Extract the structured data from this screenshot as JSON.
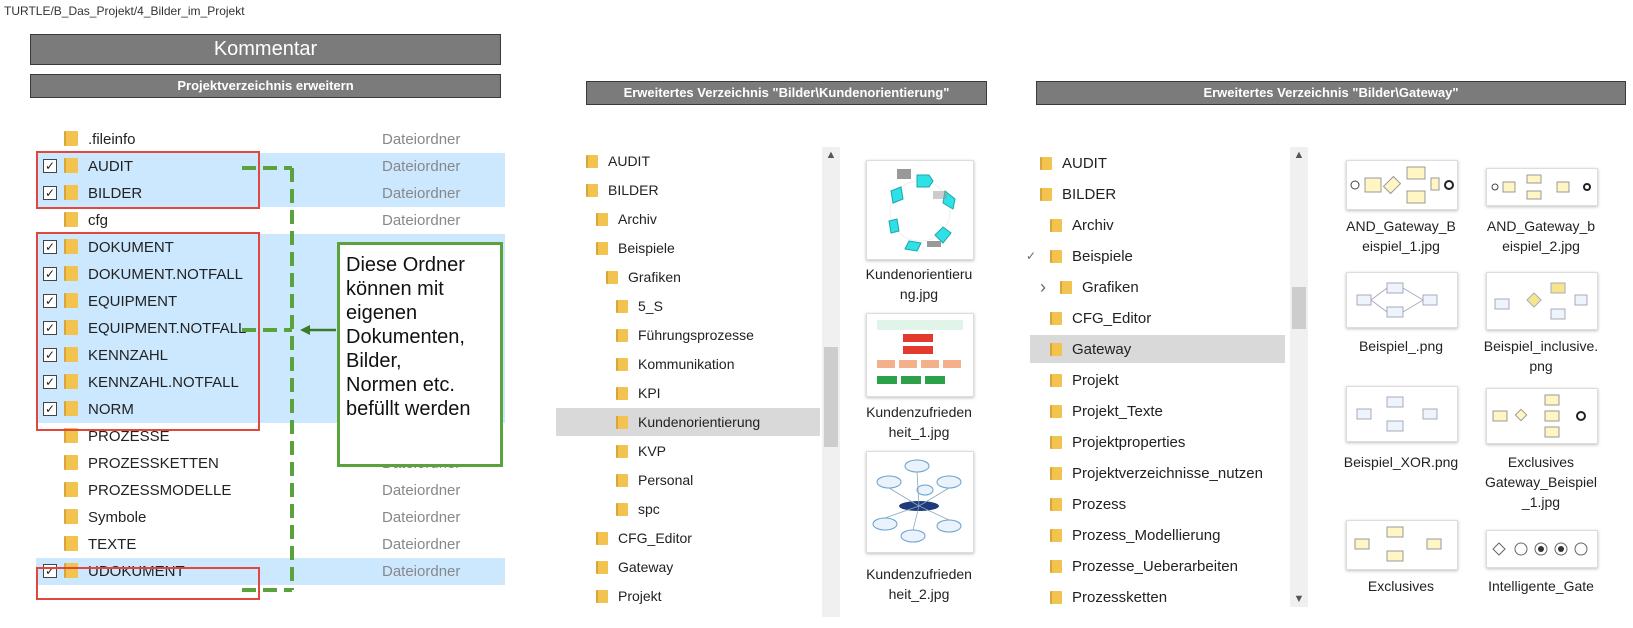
{
  "breadcrumb": "TURTLE/B_Das_Projekt/4_Bilder_im_Projekt",
  "title": "Kommentar",
  "left_panel": {
    "header": "Projektverzeichnis erweitern",
    "rows": [
      {
        "name": ".fileinfo",
        "type": "Dateiordner",
        "checked": false,
        "selected": false
      },
      {
        "name": "AUDIT",
        "type": "Dateiordner",
        "checked": true,
        "selected": true
      },
      {
        "name": "BILDER",
        "type": "Dateiordner",
        "checked": true,
        "selected": true
      },
      {
        "name": "cfg",
        "type": "Dateiordner",
        "checked": false,
        "selected": false
      },
      {
        "name": "DOKUMENT",
        "type": "",
        "checked": true,
        "selected": true
      },
      {
        "name": "DOKUMENT.NOTFALL",
        "type": "",
        "checked": true,
        "selected": true
      },
      {
        "name": "EQUIPMENT",
        "type": "",
        "checked": true,
        "selected": true
      },
      {
        "name": "EQUIPMENT.NOTFALL",
        "type": "",
        "checked": true,
        "selected": true
      },
      {
        "name": "KENNZAHL",
        "type": "",
        "checked": true,
        "selected": true
      },
      {
        "name": "KENNZAHL.NOTFALL",
        "type": "",
        "checked": true,
        "selected": true
      },
      {
        "name": "NORM",
        "type": "",
        "checked": true,
        "selected": true
      },
      {
        "name": "PROZESSE",
        "type": "",
        "checked": false,
        "selected": false
      },
      {
        "name": "PROZESSKETTEN",
        "type": "Dateiordner",
        "checked": false,
        "selected": false
      },
      {
        "name": "PROZESSMODELLE",
        "type": "Dateiordner",
        "checked": false,
        "selected": false
      },
      {
        "name": "Symbole",
        "type": "Dateiordner",
        "checked": false,
        "selected": false
      },
      {
        "name": "TEXTE",
        "type": "Dateiordner",
        "checked": false,
        "selected": false
      },
      {
        "name": "UDOKUMENT",
        "type": "Dateiordner",
        "checked": true,
        "selected": true
      }
    ],
    "comment_lines": [
      "Diese Ordner",
      "können mit",
      "eigenen",
      "Dokumenten,",
      "Bilder,",
      "Normen etc.",
      "befüllt werden"
    ]
  },
  "middle_panel": {
    "header": "Erweitertes Verzeichnis \"Bilder\\Kundenorientierung\"",
    "tree": [
      {
        "name": "AUDIT",
        "indent": 0
      },
      {
        "name": "BILDER",
        "indent": 0
      },
      {
        "name": "Archiv",
        "indent": 1
      },
      {
        "name": "Beispiele",
        "indent": 1
      },
      {
        "name": "Grafiken",
        "indent": 2
      },
      {
        "name": "5_S",
        "indent": 3
      },
      {
        "name": "Führungsprozesse",
        "indent": 3
      },
      {
        "name": "Kommunikation",
        "indent": 3
      },
      {
        "name": "KPI",
        "indent": 3
      },
      {
        "name": "Kundenorientierung",
        "indent": 3,
        "selected": true
      },
      {
        "name": "KVP",
        "indent": 3
      },
      {
        "name": "Personal",
        "indent": 3
      },
      {
        "name": "spc",
        "indent": 3
      },
      {
        "name": "CFG_Editor",
        "indent": 1
      },
      {
        "name": "Gateway",
        "indent": 1
      },
      {
        "name": "Projekt",
        "indent": 1
      }
    ],
    "files": [
      {
        "line1": "Kundenorientieru",
        "line2": "ng.jpg"
      },
      {
        "line1": "Kundenzufrieden",
        "line2": "heit_1.jpg"
      },
      {
        "line1": "Kundenzufrieden",
        "line2": "heit_2.jpg"
      }
    ]
  },
  "right_panel": {
    "header": "Erweitertes Verzeichnis \"Bilder\\Gateway\"",
    "tree": [
      {
        "name": "AUDIT",
        "indent": 0,
        "mark": ""
      },
      {
        "name": "BILDER",
        "indent": 0,
        "mark": ""
      },
      {
        "name": "Archiv",
        "indent": 1,
        "mark": ""
      },
      {
        "name": "Beispiele",
        "indent": 1,
        "mark": "✓"
      },
      {
        "name": "Grafiken",
        "indent": 2,
        "mark": "›"
      },
      {
        "name": "CFG_Editor",
        "indent": 1,
        "mark": ""
      },
      {
        "name": "Gateway",
        "indent": 1,
        "mark": "",
        "selected": true
      },
      {
        "name": "Projekt",
        "indent": 1,
        "mark": ""
      },
      {
        "name": "Projekt_Texte",
        "indent": 1,
        "mark": ""
      },
      {
        "name": "Projektproperties",
        "indent": 1,
        "mark": ""
      },
      {
        "name": "Projektverzeichnisse_nutzen",
        "indent": 1,
        "mark": ""
      },
      {
        "name": "Prozess",
        "indent": 1,
        "mark": ""
      },
      {
        "name": "Prozess_Modellierung",
        "indent": 1,
        "mark": ""
      },
      {
        "name": "Prozesse_Ueberarbeiten",
        "indent": 1,
        "mark": ""
      },
      {
        "name": "Prozessketten",
        "indent": 1,
        "mark": ""
      }
    ],
    "files": [
      {
        "line1": "AND_Gateway_B",
        "line2": "eispiel_1.jpg",
        "line3": ""
      },
      {
        "line1": "AND_Gateway_b",
        "line2": "eispiel_2.jpg",
        "line3": ""
      },
      {
        "line1": "Beispiel_.png",
        "line2": "",
        "line3": ""
      },
      {
        "line1": "Beispiel_inclusive.",
        "line2": "png",
        "line3": ""
      },
      {
        "line1": "Beispiel_XOR.png",
        "line2": "",
        "line3": ""
      },
      {
        "line1": "Exclusives",
        "line2": "Gateway_Beispiel",
        "line3": "_1.jpg"
      },
      {
        "line1": "Exclusives",
        "line2": "",
        "line3": ""
      },
      {
        "line1": "Intelligente_Gate",
        "line2": "",
        "line3": ""
      }
    ]
  },
  "colors": {
    "selection": "#cce8ff",
    "highlight_box": "#e0473d",
    "comment_border": "#5aa33c",
    "folder": "#f2c34e",
    "header_bar": "#7b7b7b"
  }
}
